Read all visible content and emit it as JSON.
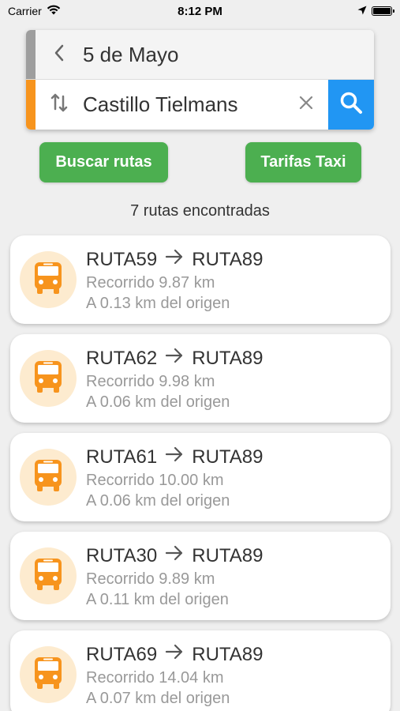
{
  "status_bar": {
    "carrier": "Carrier",
    "time": "8:12 PM"
  },
  "search": {
    "origin": "5 de Mayo",
    "destination": "Castillo Tielmans",
    "accent_origin": "#9e9e9e",
    "accent_destination": "#f7941d",
    "search_button_color": "#2196f3"
  },
  "actions": {
    "buscar_label": "Buscar rutas",
    "taxi_label": "Tarifas Taxi",
    "button_color": "#4caf50"
  },
  "results": {
    "count_text": "7 rutas encontradas",
    "routes": [
      {
        "from": "RUTA59",
        "to": "RUTA89",
        "distance": "Recorrido 9.87 km",
        "origin_distance": "A 0.13 km del origen"
      },
      {
        "from": "RUTA62",
        "to": "RUTA89",
        "distance": "Recorrido 9.98 km",
        "origin_distance": "A 0.06 km del origen"
      },
      {
        "from": "RUTA61",
        "to": "RUTA89",
        "distance": "Recorrido 10.00 km",
        "origin_distance": "A 0.06 km del origen"
      },
      {
        "from": "RUTA30",
        "to": "RUTA89",
        "distance": "Recorrido 9.89 km",
        "origin_distance": "A 0.11 km del origen"
      },
      {
        "from": "RUTA69",
        "to": "RUTA89",
        "distance": "Recorrido 14.04 km",
        "origin_distance": "A 0.07 km del origen"
      }
    ]
  },
  "icons": {
    "back": "chevron-left-icon",
    "swap": "swap-vertical-icon",
    "clear": "close-icon",
    "search": "search-icon",
    "bus": "bus-icon",
    "arrow": "arrow-right-icon"
  }
}
